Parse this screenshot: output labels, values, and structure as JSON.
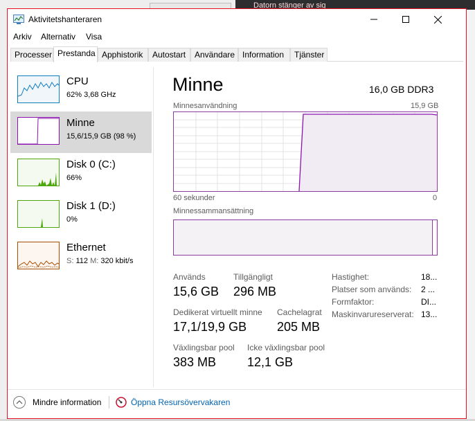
{
  "window": {
    "title": "Aktivitetshanteraren",
    "background_banner": "Datorn stänger av sig"
  },
  "menu": [
    "Arkiv",
    "Alternativ",
    "Visa"
  ],
  "tabs": [
    "Processer",
    "Prestanda",
    "Apphistorik",
    "Autostart",
    "Användare",
    "Information",
    "Tjänster"
  ],
  "active_tab": "Prestanda",
  "sidebar": {
    "items": [
      {
        "name": "CPU",
        "sub": "62% 3,68 GHz",
        "color": "#117dbb"
      },
      {
        "name": "Minne",
        "sub": "15,6/15,9 GB (98 %)",
        "color": "#8b12ae"
      },
      {
        "name": "Disk 0 (C:)",
        "sub": "66%",
        "color": "#4da60c"
      },
      {
        "name": "Disk 1 (D:)",
        "sub": "0%",
        "color": "#4da60c"
      },
      {
        "name": "Ethernet",
        "sub_s_label": "S:",
        "sub_s_value": "112",
        "sub_m_label": "M:",
        "sub_m_value": "320 kbit/s",
        "color": "#a74f01"
      }
    ]
  },
  "main": {
    "heading": "Minne",
    "capacity": "16,0 GB DDR3",
    "usage_graph": {
      "label": "Minnesanvändning",
      "max_label": "15,9 GB",
      "time_label": "60 sekunder",
      "zero_label": "0"
    },
    "composition_label": "Minnessammansättning",
    "stats": {
      "in_use_label": "Används",
      "in_use_value": "15,6 GB",
      "available_label": "Tillgängligt",
      "available_value": "296 MB",
      "committed_label": "Dedikerat virtuellt minne",
      "committed_value": "17,1/19,9 GB",
      "cached_label": "Cachelagrat",
      "cached_value": "205 MB",
      "paged_label": "Växlingsbar pool",
      "paged_value": "383 MB",
      "nonpaged_label": "Icke växlingsbar pool",
      "nonpaged_value": "12,1 GB"
    },
    "details": [
      {
        "label": "Hastighet:",
        "value": "18..."
      },
      {
        "label": "Platser som används:",
        "value": "2 ..."
      },
      {
        "label": "Formfaktor:",
        "value": "DI..."
      },
      {
        "label": "Maskinvarureserverat:",
        "value": "13..."
      }
    ]
  },
  "footer": {
    "fewer_details": "Mindre information",
    "resource_monitor": "Öppna Resursövervakaren"
  }
}
